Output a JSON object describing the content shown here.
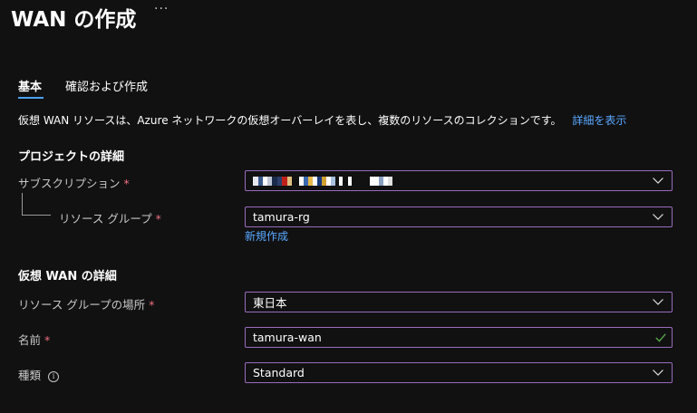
{
  "header": {
    "title": "WAN の作成",
    "more_label": "···"
  },
  "tabs": [
    {
      "label": "基本",
      "active": true
    },
    {
      "label": "確認および作成",
      "active": false
    }
  ],
  "description": {
    "text": "仮想 WAN リソースは、Azure ネットワークの仮想オーバーレイを表し、複数のリソースのコレクションです。",
    "link": "詳細を表示"
  },
  "project_section": {
    "title": "プロジェクトの詳細",
    "subscription": {
      "label": "サブスクリプション",
      "required": "*",
      "value_redacted": true
    },
    "resource_group": {
      "label": "リソース グループ",
      "required": "*",
      "value": "tamura-rg",
      "create_new_link": "新規作成"
    }
  },
  "wan_section": {
    "title": "仮想 WAN の詳細",
    "location": {
      "label": "リソース グループの場所",
      "required": "*",
      "value": "東日本"
    },
    "name": {
      "label": "名前",
      "required": "*",
      "value": "tamura-wan"
    },
    "type": {
      "label": "種類",
      "info_icon": "i",
      "value": "Standard"
    }
  },
  "colors": {
    "background": "#111112",
    "accent_link": "#5aa9ff",
    "field_border": "#9a6bbd",
    "required": "#f1707b",
    "valid_check": "#57a64a",
    "tab_underline": "#4aa0f0"
  }
}
